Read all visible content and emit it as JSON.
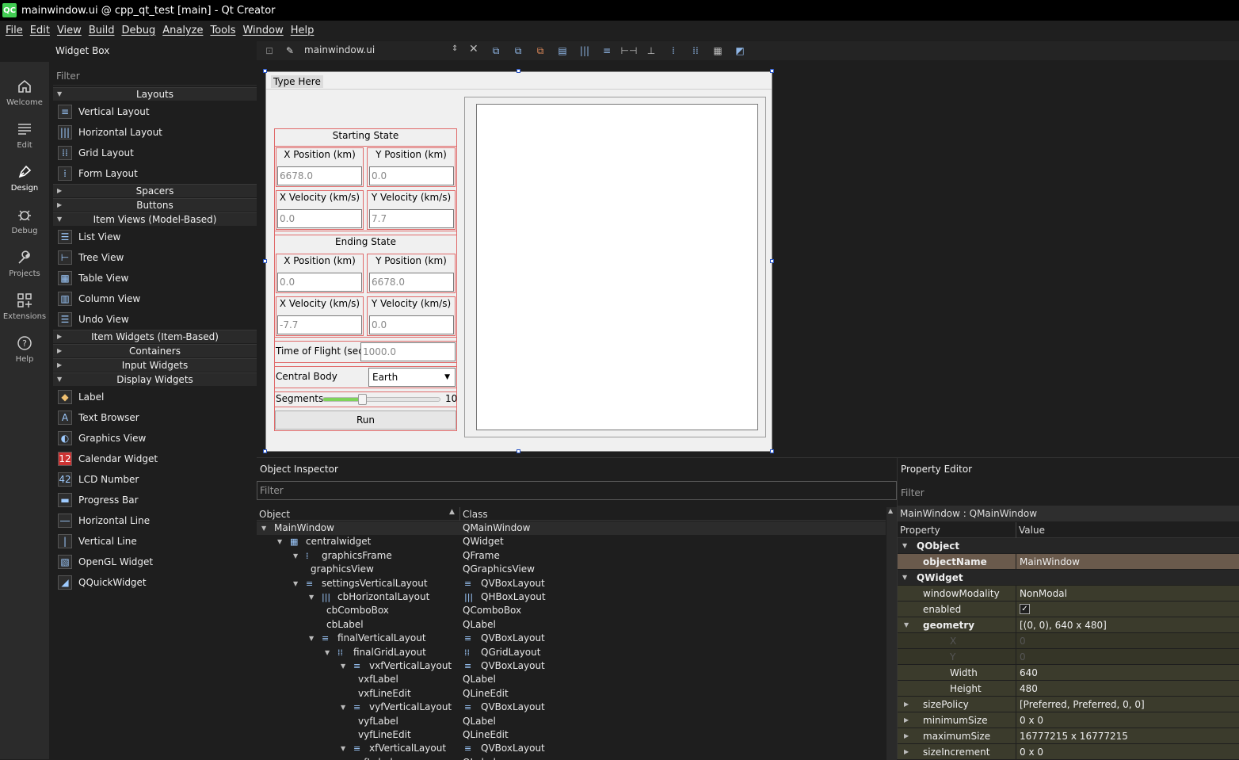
{
  "window": {
    "title": "mainwindow.ui @ cpp_qt_test [main] - Qt Creator",
    "logo": "QC"
  },
  "menu": [
    "File",
    "Edit",
    "View",
    "Build",
    "Debug",
    "Analyze",
    "Tools",
    "Window",
    "Help"
  ],
  "modes": [
    {
      "label": "Welcome",
      "icon": "home-icon"
    },
    {
      "label": "Edit",
      "icon": "edit-lines-icon"
    },
    {
      "label": "Design",
      "icon": "pen-icon"
    },
    {
      "label": "Debug",
      "icon": "bug-icon"
    },
    {
      "label": "Projects",
      "icon": "wrench-icon"
    },
    {
      "label": "Extensions",
      "icon": "grid-plus-icon"
    },
    {
      "label": "Help",
      "icon": "question-icon"
    }
  ],
  "widget_box": {
    "title": "Widget Box",
    "filter_placeholder": "Filter",
    "categories": {
      "layouts": "Layouts",
      "spacers": "Spacers",
      "buttons": "Buttons",
      "item_views": "Item Views (Model-Based)",
      "item_widgets": "Item Widgets (Item-Based)",
      "containers": "Containers",
      "input_widgets": "Input Widgets",
      "display_widgets": "Display Widgets"
    },
    "layouts": [
      "Vertical Layout",
      "Horizontal Layout",
      "Grid Layout",
      "Form Layout"
    ],
    "item_views": [
      "List View",
      "Tree View",
      "Table View",
      "Column View",
      "Undo View"
    ],
    "display_widgets": [
      "Label",
      "Text Browser",
      "Graphics View",
      "Calendar Widget",
      "LCD Number",
      "Progress Bar",
      "Horizontal Line",
      "Vertical Line",
      "OpenGL Widget",
      "QQuickWidget"
    ]
  },
  "editor": {
    "file": "mainwindow.ui"
  },
  "form": {
    "menu_placeholder": "Type Here",
    "starting_state": "Starting State",
    "ending_state": "Ending State",
    "x_position": "X Position (km)",
    "y_position": "Y Position (km)",
    "x_velocity": "X Velocity (km/s)",
    "y_velocity": "Y Velocity (km/s)",
    "start_x_pos": "6678.0",
    "start_y_pos": "0.0",
    "start_x_vel": "0.0",
    "start_y_vel": "7.7",
    "end_x_pos": "0.0",
    "end_y_pos": "6678.0",
    "end_x_vel": "-7.7",
    "end_y_vel": "0.0",
    "tof_label": "Time of Flight (sec)",
    "tof_value": "1000.0",
    "central_body_label": "Central Body",
    "central_body_value": "Earth",
    "segments_label": "Segments",
    "segments_value": "10",
    "segments_fraction": 0.33,
    "run_label": "Run"
  },
  "object_inspector": {
    "title": "Object Inspector",
    "filter_placeholder": "Filter",
    "col_object": "Object",
    "col_class": "Class",
    "rows": [
      {
        "obj": "MainWindow",
        "cls": "QMainWindow",
        "depth": 0,
        "exp": true,
        "icon": ""
      },
      {
        "obj": "centralwidget",
        "cls": "QWidget",
        "depth": 1,
        "exp": true,
        "icon": "broken-layout-icon"
      },
      {
        "obj": "graphicsFrame",
        "cls": "QFrame",
        "depth": 2,
        "exp": true,
        "icon": "form-layout-icon"
      },
      {
        "obj": "graphicsView",
        "cls": "QGraphicsView",
        "depth": 3,
        "exp": false,
        "icon": ""
      },
      {
        "obj": "settingsVerticalLayout",
        "cls": "QVBoxLayout",
        "depth": 2,
        "exp": true,
        "icon": "vbox-icon"
      },
      {
        "obj": "cbHorizontalLayout",
        "cls": "QHBoxLayout",
        "depth": 3,
        "exp": true,
        "icon": "hbox-icon"
      },
      {
        "obj": "cbComboBox",
        "cls": "QComboBox",
        "depth": 4,
        "exp": false,
        "icon": ""
      },
      {
        "obj": "cbLabel",
        "cls": "QLabel",
        "depth": 4,
        "exp": false,
        "icon": ""
      },
      {
        "obj": "finalVerticalLayout",
        "cls": "QVBoxLayout",
        "depth": 3,
        "exp": true,
        "icon": "vbox-icon"
      },
      {
        "obj": "finalGridLayout",
        "cls": "QGridLayout",
        "depth": 4,
        "exp": true,
        "icon": "grid-icon"
      },
      {
        "obj": "vxfVerticalLayout",
        "cls": "QVBoxLayout",
        "depth": 5,
        "exp": true,
        "icon": "vbox-icon"
      },
      {
        "obj": "vxfLabel",
        "cls": "QLabel",
        "depth": 6,
        "exp": false,
        "icon": ""
      },
      {
        "obj": "vxfLineEdit",
        "cls": "QLineEdit",
        "depth": 6,
        "exp": false,
        "icon": ""
      },
      {
        "obj": "vyfVerticalLayout",
        "cls": "QVBoxLayout",
        "depth": 5,
        "exp": true,
        "icon": "vbox-icon"
      },
      {
        "obj": "vyfLabel",
        "cls": "QLabel",
        "depth": 6,
        "exp": false,
        "icon": ""
      },
      {
        "obj": "vyfLineEdit",
        "cls": "QLineEdit",
        "depth": 6,
        "exp": false,
        "icon": ""
      },
      {
        "obj": "xfVerticalLayout",
        "cls": "QVBoxLayout",
        "depth": 5,
        "exp": true,
        "icon": "vbox-icon"
      },
      {
        "obj": "xfLabel",
        "cls": "QLabel",
        "depth": 6,
        "exp": false,
        "icon": ""
      }
    ]
  },
  "property_editor": {
    "title": "Property Editor",
    "filter_placeholder": "Filter",
    "object_line": "MainWindow : QMainWindow",
    "col_property": "Property",
    "col_value": "Value",
    "rows": [
      {
        "name": "QObject",
        "value": "",
        "kind": "group",
        "indent": 0,
        "exp": "open"
      },
      {
        "name": "objectName",
        "value": "MainWindow",
        "kind": "sel",
        "indent": 1,
        "exp": ""
      },
      {
        "name": "QWidget",
        "value": "",
        "kind": "group",
        "indent": 0,
        "exp": "open"
      },
      {
        "name": "windowModality",
        "value": "NonModal",
        "kind": "prop",
        "indent": 1,
        "exp": ""
      },
      {
        "name": "enabled",
        "value": "✓",
        "kind": "check",
        "indent": 1,
        "exp": ""
      },
      {
        "name": "geometry",
        "value": "[(0, 0), 640 x 480]",
        "kind": "propbold",
        "indent": 1,
        "exp": "open"
      },
      {
        "name": "X",
        "value": "0",
        "kind": "dim",
        "indent": 2,
        "exp": ""
      },
      {
        "name": "Y",
        "value": "0",
        "kind": "dim",
        "indent": 2,
        "exp": ""
      },
      {
        "name": "Width",
        "value": "640",
        "kind": "prop",
        "indent": 2,
        "exp": ""
      },
      {
        "name": "Height",
        "value": "480",
        "kind": "prop",
        "indent": 2,
        "exp": ""
      },
      {
        "name": "sizePolicy",
        "value": "[Preferred, Preferred, 0, 0]",
        "kind": "prop",
        "indent": 1,
        "exp": "closed"
      },
      {
        "name": "minimumSize",
        "value": "0 x 0",
        "kind": "prop",
        "indent": 1,
        "exp": "closed"
      },
      {
        "name": "maximumSize",
        "value": "16777215 x 16777215",
        "kind": "prop",
        "indent": 1,
        "exp": "closed"
      },
      {
        "name": "sizeIncrement",
        "value": "0 x 0",
        "kind": "prop",
        "indent": 1,
        "exp": "closed"
      }
    ]
  },
  "colors": {
    "accent": "#41cd52",
    "selection": "#2a56c6",
    "layout_red": "#e06a6a",
    "prop_bg": "#3a3a2a",
    "prop_sel": "#6b5a4a"
  }
}
